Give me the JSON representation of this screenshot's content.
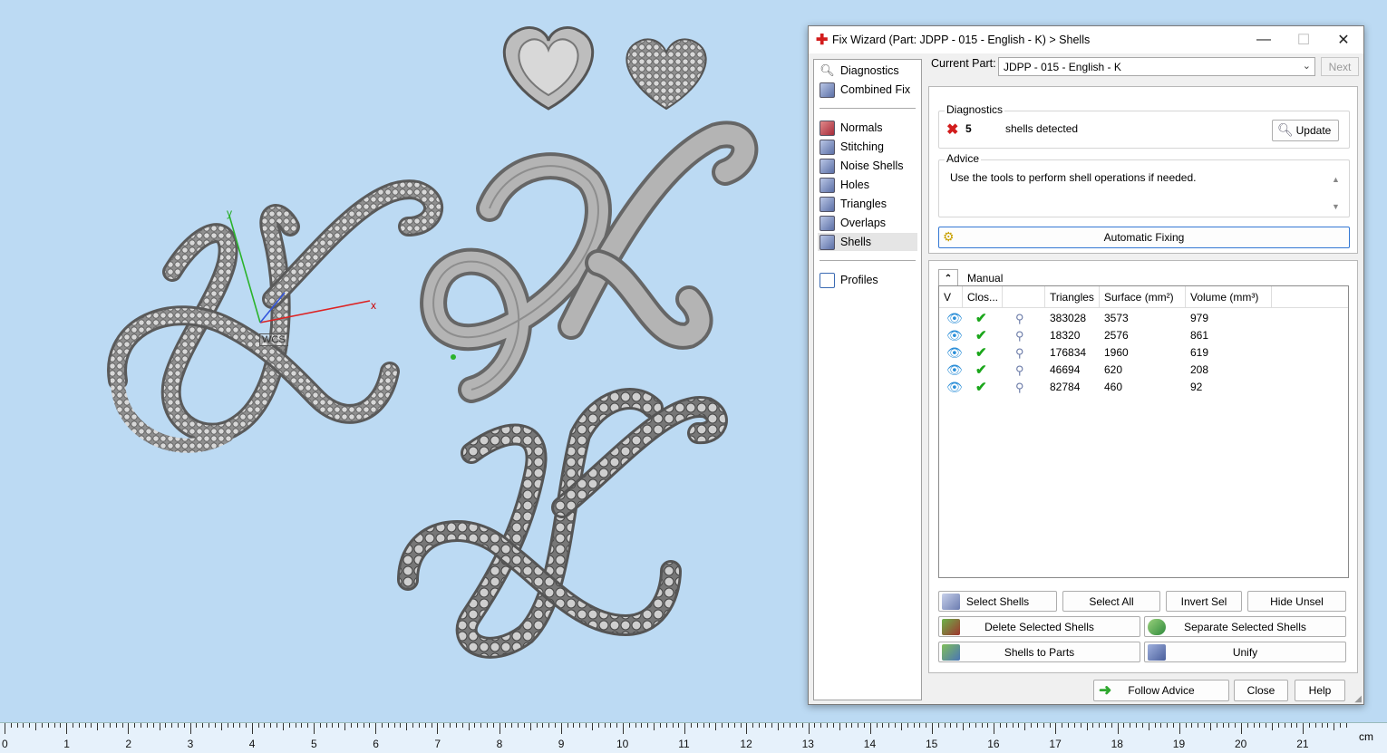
{
  "dialog": {
    "title": "Fix Wizard (Part: JDPP - 015 - English - K) > Shells",
    "minimize": "—",
    "maximize": "☐",
    "close": "✕",
    "nav": [
      {
        "label": "Diagnostics"
      },
      {
        "label": "Combined Fix"
      },
      {
        "label": "Normals"
      },
      {
        "label": "Stitching"
      },
      {
        "label": "Noise Shells"
      },
      {
        "label": "Holes"
      },
      {
        "label": "Triangles"
      },
      {
        "label": "Overlaps"
      },
      {
        "label": "Shells",
        "selected": true
      },
      {
        "label": "Profiles"
      }
    ],
    "current_part_label": "Current Part:",
    "current_part_value": "JDPP - 015 - English - K",
    "next_label": "Next",
    "diagnostics": {
      "title": "Diagnostics",
      "count": "5",
      "message": "shells detected",
      "update_label": "Update"
    },
    "advice": {
      "title": "Advice",
      "text": "Use the tools to perform shell operations if needed."
    },
    "automatic_fixing_label": "Automatic Fixing",
    "manual": {
      "title": "Manual",
      "columns": [
        "V",
        "Clos...",
        "",
        "Triangles",
        "Surface (mm²)",
        "Volume (mm³)"
      ],
      "rows": [
        {
          "triangles": "383028",
          "surface": "3573",
          "volume": "979"
        },
        {
          "triangles": "18320",
          "surface": "2576",
          "volume": "861"
        },
        {
          "triangles": "176834",
          "surface": "1960",
          "volume": "619"
        },
        {
          "triangles": "46694",
          "surface": "620",
          "volume": "208"
        },
        {
          "triangles": "82784",
          "surface": "460",
          "volume": "92"
        }
      ],
      "buttons": {
        "select_shells": "Select Shells",
        "select_all": "Select All",
        "invert_sel": "Invert Sel",
        "hide_unsel": "Hide Unsel",
        "delete_selected": "Delete Selected Shells",
        "separate_selected": "Separate Selected Shells",
        "shells_to_parts": "Shells to Parts",
        "unify": "Unify"
      }
    },
    "footer": {
      "follow_advice": "Follow Advice",
      "close": "Close",
      "help": "Help"
    }
  },
  "viewport": {
    "wcs_label": "WCS",
    "axis_x": "x",
    "axis_y": "y"
  },
  "ruler": {
    "unit": "cm",
    "numbers": [
      "0",
      "1",
      "2",
      "3",
      "4",
      "5",
      "6",
      "7",
      "8",
      "9",
      "10",
      "11",
      "12",
      "13",
      "14",
      "15",
      "16",
      "17",
      "18",
      "19",
      "20",
      "21"
    ]
  },
  "colors": {
    "viewport_bg": "#bcdaf3",
    "model_gray": "#9a9a9a",
    "accent_blue": "#2c8fd8",
    "check_green": "#1aa61a",
    "error_red": "#d21c1c"
  }
}
